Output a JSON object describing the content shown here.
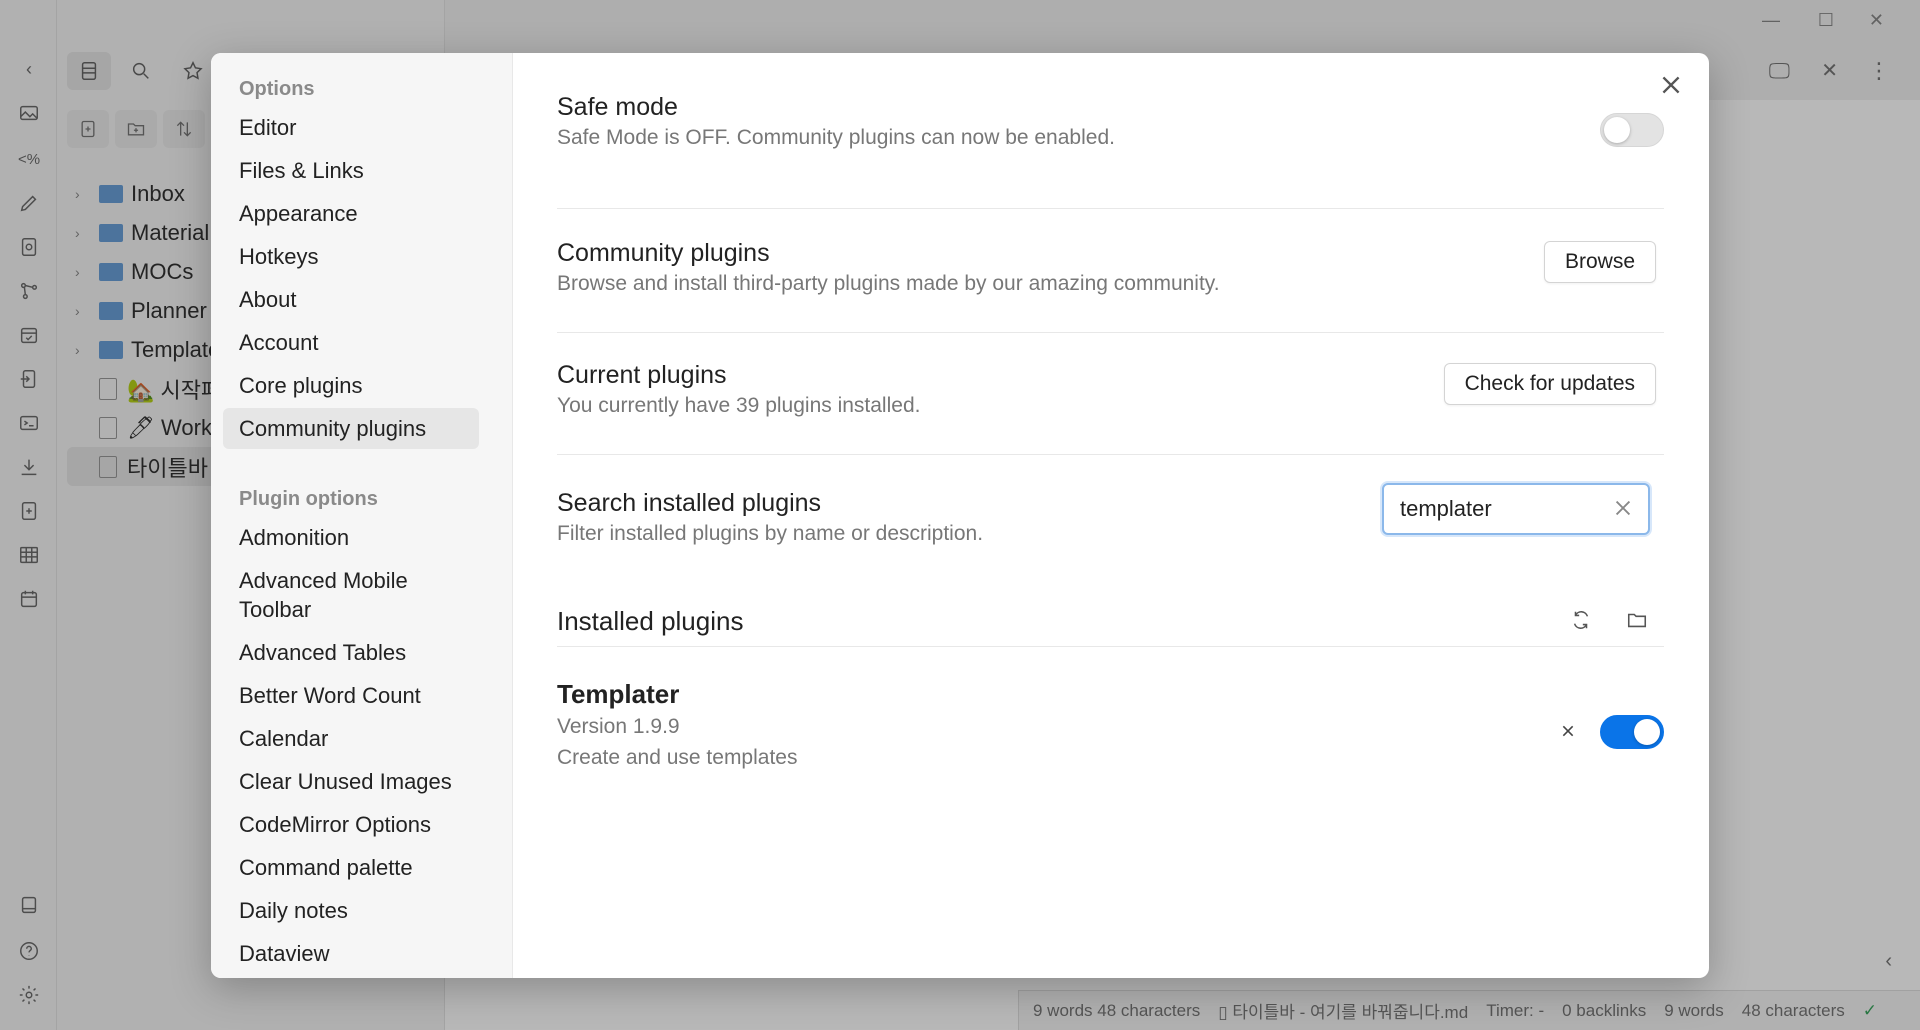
{
  "sidebar": {
    "tree": [
      {
        "type": "folder",
        "label": "Inbox"
      },
      {
        "type": "folder",
        "label": "Material"
      },
      {
        "type": "folder",
        "label": "MOCs"
      },
      {
        "type": "folder",
        "label": "Planner"
      },
      {
        "type": "folder",
        "label": "Template"
      },
      {
        "type": "file",
        "label": "🏡 시작페"
      },
      {
        "type": "file",
        "label": "🖊 Workb"
      },
      {
        "type": "file",
        "label": "타이틀바 -"
      }
    ]
  },
  "statusbar": {
    "word_count": "9 words 48 characters",
    "file": "타이틀바 - 여기를 바꿔줍니다.md",
    "timer": "Timer: -",
    "backlinks": "0 backlinks",
    "words": "9 words",
    "characters": "48 characters"
  },
  "nav": {
    "options_heading": "Options",
    "options": [
      "Editor",
      "Files & Links",
      "Appearance",
      "Hotkeys",
      "About",
      "Account",
      "Core plugins",
      "Community plugins"
    ],
    "active": "Community plugins",
    "plugin_heading": "Plugin options",
    "plugin_options": [
      "Admonition",
      "Advanced Mobile Toolbar",
      "Advanced Tables",
      "Better Word Count",
      "Calendar",
      "Clear Unused Images",
      "CodeMirror Options",
      "Command palette",
      "Daily notes",
      "Dataview"
    ]
  },
  "settings": {
    "safe_mode": {
      "name": "Safe mode",
      "desc": "Safe Mode is OFF. Community plugins can now be enabled.",
      "enabled": false
    },
    "community": {
      "name": "Community plugins",
      "desc": "Browse and install third-party plugins made by our amazing community.",
      "button": "Browse"
    },
    "current": {
      "name": "Current plugins",
      "desc": "You currently have 39 plugins installed.",
      "button": "Check for updates"
    },
    "search": {
      "name": "Search installed plugins",
      "desc": "Filter installed plugins by name or description.",
      "value": "templater"
    },
    "installed_heading": "Installed plugins",
    "plugin": {
      "name": "Templater",
      "version": "Version 1.9.9",
      "desc": "Create and use templates",
      "enabled": true
    }
  },
  "colors": {
    "accent": "#0a74e8",
    "overlay": "rgba(0,0,0,0.28)"
  }
}
